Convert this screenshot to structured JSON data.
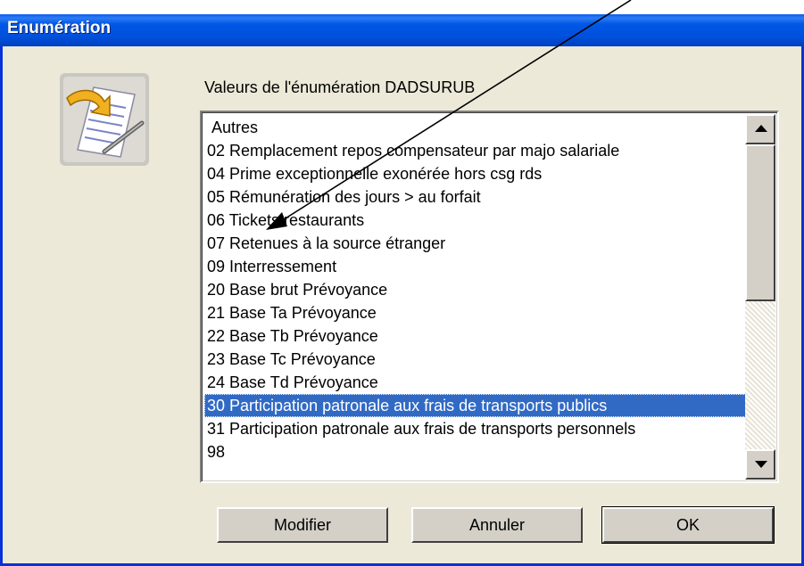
{
  "window": {
    "title": "Enumération"
  },
  "dialog": {
    "label": "Valeurs de l'énumération DADSURUB",
    "items": [
      "Autres",
      "02 Remplacement repos compensateur par majo salariale",
      "04 Prime exceptionnelle exonérée hors csg rds",
      "05 Rémunération des jours > au forfait",
      "06 Tickets restaurants",
      "07 Retenues à la source étranger",
      "09 Interressement",
      "20 Base brut Prévoyance",
      "21 Base Ta Prévoyance",
      "22 Base Tb Prévoyance",
      "23 Base Tc Prévoyance",
      "24 Base Td Prévoyance",
      "30 Participation patronale aux frais de transports publics",
      "31 Participation patronale aux frais de transports personnels",
      "98"
    ],
    "selected_item": "30 Participation patronale aux frais de transports publics"
  },
  "buttons": {
    "modify": "Modifier",
    "cancel": "Annuler",
    "ok": "OK"
  },
  "icons": {
    "app": "document-edit-icon",
    "scroll_up": "arrow-up-icon",
    "scroll_down": "arrow-down-icon",
    "annotation": "arrow-annotation"
  },
  "colors": {
    "titlebar": "#0054e3",
    "selection": "#316ac5",
    "dialog_bg": "#ece9d8",
    "frame": "#0831d9"
  }
}
